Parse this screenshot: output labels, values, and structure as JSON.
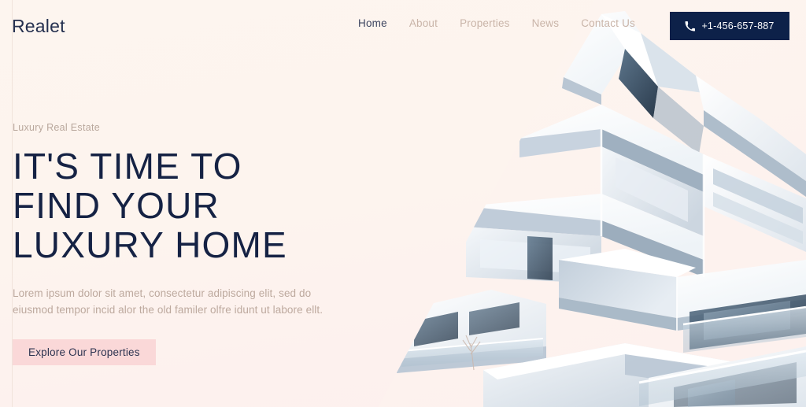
{
  "brand": {
    "logo_text": "Realet"
  },
  "nav": {
    "items": [
      {
        "label": "Home",
        "active": true
      },
      {
        "label": "About",
        "active": false
      },
      {
        "label": "Properties",
        "active": false
      },
      {
        "label": "News",
        "active": false
      },
      {
        "label": "Contact Us",
        "active": false
      }
    ]
  },
  "phone_button": {
    "icon": "phone-icon",
    "label": "+1-456-657-887"
  },
  "hero": {
    "eyebrow": "Luxury Real Estate",
    "headline": "IT'S TIME TO\nFIND YOUR\nLUXURY HOME",
    "subcopy": "Lorem ipsum dolor sit amet, consectetur adipiscing elit, sed do\neiusmod tempor incid alor the old familer olfre idunt ut labore ellt.",
    "cta_label": "Explore Our Properties",
    "image_alt": "modern-white-apartment-building-corner-upward-view"
  },
  "colors": {
    "background": "#fdf4ee",
    "navy": "#152244",
    "navy_button": "#0d2149",
    "cta_pink": "#fad8d8",
    "muted_text": "#bda99e",
    "nav_inactive": "#c9b4a8",
    "rule": "#f0e3db"
  }
}
